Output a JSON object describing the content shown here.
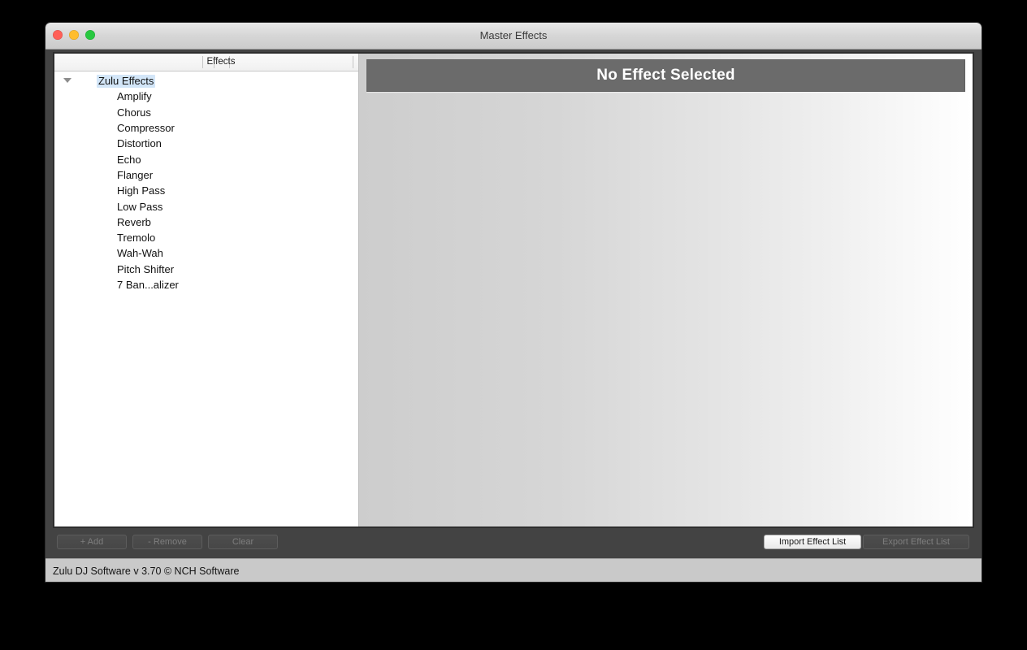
{
  "window": {
    "title": "Master Effects",
    "traffic_lights": [
      {
        "name": "close",
        "color": "#ff5f57"
      },
      {
        "name": "minimize",
        "color": "#ffbd2e"
      },
      {
        "name": "maximize",
        "color": "#28c840"
      }
    ]
  },
  "left_pane": {
    "column_header": "Effects",
    "tree": {
      "root": {
        "label": "Zulu Effects",
        "expanded": true,
        "selected": true,
        "disclosure_icon": "triangle-down-icon"
      },
      "children": [
        {
          "label": "Amplify"
        },
        {
          "label": "Chorus"
        },
        {
          "label": "Compressor"
        },
        {
          "label": "Distortion"
        },
        {
          "label": "Echo"
        },
        {
          "label": "Flanger"
        },
        {
          "label": "High Pass"
        },
        {
          "label": "Low Pass"
        },
        {
          "label": "Reverb"
        },
        {
          "label": "Tremolo"
        },
        {
          "label": "Wah-Wah"
        },
        {
          "label": "Pitch Shifter"
        },
        {
          "label": "7 Ban...alizer"
        }
      ]
    }
  },
  "right_pane": {
    "header_title": "No Effect Selected",
    "header_bg": "#6b6b6b",
    "header_text_color": "#ffffff"
  },
  "toolbar": {
    "add_label": "+ Add",
    "remove_label": "- Remove",
    "clear_label": "Clear",
    "import_label": "Import Effect List",
    "export_label": "Export Effect List"
  },
  "statusbar": {
    "text": "Zulu DJ Software v 3.70 © NCH Software"
  }
}
